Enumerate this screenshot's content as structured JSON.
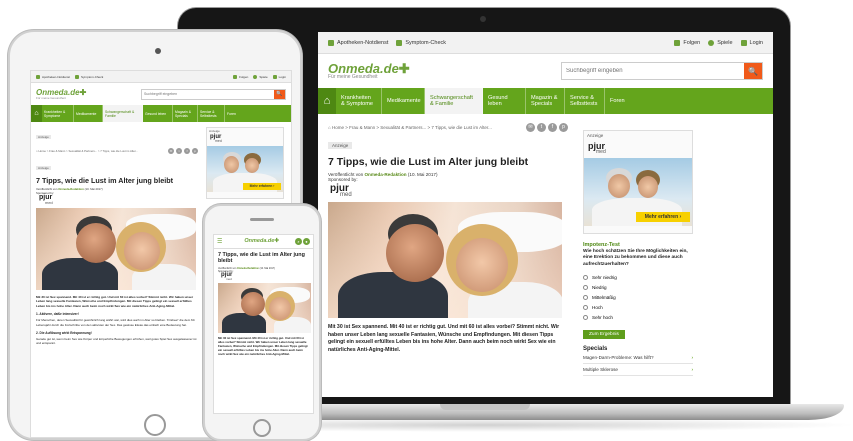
{
  "site": {
    "logo": "Onmeda.de",
    "logo_cross": "✚",
    "tagline": "Für meine Gesundheit",
    "util_left": [
      "Apotheken-Notdienst",
      "Symptom-Check"
    ],
    "util_right": [
      "Folgen",
      "Spiele",
      "Login"
    ],
    "search_placeholder": "Suchbegriff eingeben",
    "search_icon": "🔍",
    "nav": [
      "Krankheiten & Symptome",
      "Medikamente",
      "Schwangerschaft & Familie",
      "Gesund leben",
      "Magazin & Specials",
      "Service & Selbsttests",
      "Foren"
    ],
    "nav_active": 2,
    "home_icon": "⌂",
    "breadcrumb": "⌂ Home > Frau & Mann > Sexualität & Partners... > 7 Tipps, wie die Lust im Alter...",
    "anzeige": "Anzeige",
    "article": {
      "title": "7 Tipps, wie die Lust im Alter jung bleibt",
      "veroeffentlicht": "Veröffentlicht von",
      "author": "Onmeda-Redaktion",
      "date": "(10. Mai 2017)",
      "sponsored": "Sponsored by:",
      "sponsor_brand": "pjur",
      "sponsor_sub": "med",
      "body": "Mit 30 ist Sex spannend. Mit 40 ist er richtig gut. Und mit 60 ist alles vorbei? Stimmt nicht. Wir haben unser Leben lang sexuelle Fantasien, Wünsche und Empfindungen. Mit diesen Tipps gelingt ein sexuell erfülltes Leben bis ins hohe Alter. Dann auch beim noch wirkt Sex wie ein natürliches Anti-Aging-Mittel."
    },
    "socials": [
      "✉",
      "t",
      "f",
      "p"
    ],
    "sidebar": {
      "anzeige": "Anzeige",
      "ad_brand": "pjur",
      "ad_sub": "med",
      "ad_button": "Mehr erfahren ›",
      "poll_title": "Impotenz-Test",
      "poll_question": "Wie hoch schätzen Sie Ihre Möglichkeiten ein, eine Erektion zu bekommen und diese auch aufrechtzuerhalten?",
      "poll_options": [
        "Sehr niedrig",
        "Niedrig",
        "Mittelmäßig",
        "Hoch",
        "Sehr hoch"
      ],
      "poll_button": "Zum Ergebnis",
      "specials_title": "Specials",
      "specials": [
        "Magen-Darm-Probleme: Was hilft?",
        "Multiple Sklerose"
      ]
    },
    "tablet_body": [
      "Mit 30 ist Sex spannend. Mit 40 ist er richtig gut. Und mit 60 ist alles vorbei? Stimmt nicht. Wir haben unser Leben lang sexuelle Fantasien, Wünsche und Empfindungen. Mit diesen Tipps gelingt ein sexuell erfülltes Leben bis ins hohe Alter. Dann auch beim noch wirkt Sex wie ein natürliches Anti-Aging-Mittel.",
      "1. Aktivere, dafür intensiver!",
      "Für Menschen, deren Sexualität für gewöhnlich lang währt war, wird dies auch im Alter so bleiben. 'Frisbee!' die dem 60. Lebensjahr durch die Fortschritte von den aktivsten der Sex. Das gewisse Etwas das einfach eine Bedeutung hat.",
      "2. Die Auflösung wirkt Entspannung!",
      "Gerade gut ist, wenn beim Sex wie Körper und körperliche Bewegungen erhöhen, weil gutes Spiel Sex ausgelassener ist und entspannt."
    ]
  }
}
